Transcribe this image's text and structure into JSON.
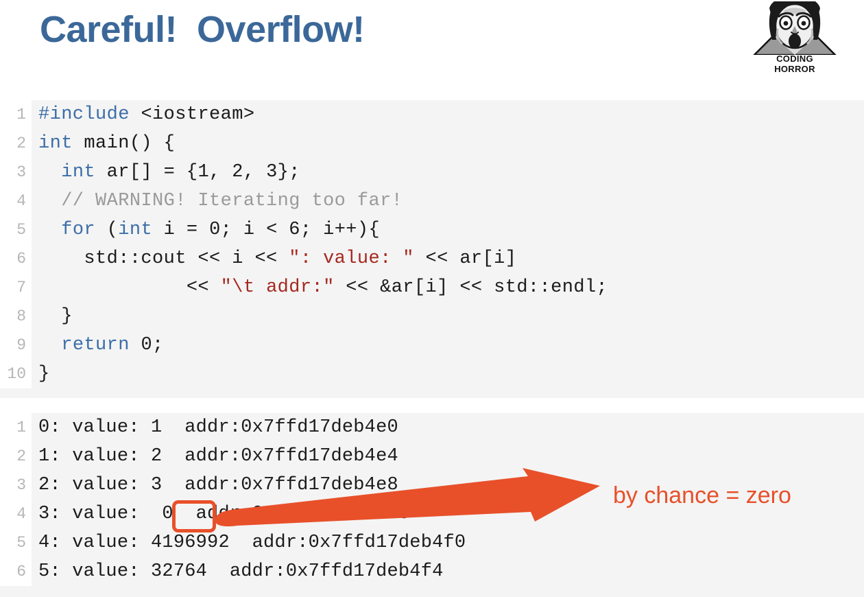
{
  "header": {
    "title": "Careful!  Overflow!",
    "title_color": "#3b6899",
    "logo": {
      "name": "coding-horror-logo",
      "line1": "CODING",
      "line2": "HORROR"
    }
  },
  "code_block": {
    "language": "cpp",
    "background": "#f4f4f4",
    "lines": [
      {
        "n": "1",
        "tokens": [
          {
            "t": "#include ",
            "c": "pre"
          },
          {
            "t": "<iostream>",
            "c": "plain"
          }
        ]
      },
      {
        "n": "2",
        "tokens": [
          {
            "t": "int",
            "c": "kw"
          },
          {
            "t": " main() {",
            "c": "plain"
          }
        ]
      },
      {
        "n": "3",
        "tokens": [
          {
            "t": "  ",
            "c": "plain"
          },
          {
            "t": "int",
            "c": "kw"
          },
          {
            "t": " ar[] = {1, 2, 3};",
            "c": "plain"
          }
        ]
      },
      {
        "n": "4",
        "tokens": [
          {
            "t": "  // WARNING! Iterating too far!",
            "c": "cmt"
          }
        ]
      },
      {
        "n": "5",
        "tokens": [
          {
            "t": "  ",
            "c": "plain"
          },
          {
            "t": "for",
            "c": "kw"
          },
          {
            "t": " (",
            "c": "plain"
          },
          {
            "t": "int",
            "c": "kw"
          },
          {
            "t": " i = 0; i < 6; i++){",
            "c": "plain"
          }
        ]
      },
      {
        "n": "6",
        "tokens": [
          {
            "t": "    std::cout << i << ",
            "c": "plain"
          },
          {
            "t": "\": value: \"",
            "c": "str"
          },
          {
            "t": " << ar[i]",
            "c": "plain"
          }
        ]
      },
      {
        "n": "7",
        "tokens": [
          {
            "t": "             << ",
            "c": "plain"
          },
          {
            "t": "\"\\t addr:\"",
            "c": "str"
          },
          {
            "t": " << &ar[i] << std::endl;",
            "c": "plain"
          }
        ]
      },
      {
        "n": "8",
        "tokens": [
          {
            "t": "  }",
            "c": "plain"
          }
        ]
      },
      {
        "n": "9",
        "tokens": [
          {
            "t": "  ",
            "c": "plain"
          },
          {
            "t": "return",
            "c": "kw"
          },
          {
            "t": " 0;",
            "c": "plain"
          }
        ]
      },
      {
        "n": "10",
        "tokens": [
          {
            "t": "}",
            "c": "plain"
          }
        ]
      }
    ]
  },
  "output_block": {
    "background": "#f4f4f4",
    "lines": [
      {
        "n": "1",
        "tokens": [
          {
            "t": "0: value: 1  addr:0x7ffd17deb4e0",
            "c": "plain"
          }
        ]
      },
      {
        "n": "2",
        "tokens": [
          {
            "t": "1: value: 2  addr:0x7ffd17deb4e4",
            "c": "plain"
          }
        ]
      },
      {
        "n": "3",
        "tokens": [
          {
            "t": "2: value: 3  addr:0x7ffd17deb4e8",
            "c": "plain"
          }
        ]
      },
      {
        "n": "4",
        "tokens": [
          {
            "t": "3: value:  0  addr:0x7ffd17deb4ec",
            "c": "plain"
          }
        ]
      },
      {
        "n": "5",
        "tokens": [
          {
            "t": "4: value: 4196992  addr:0x7ffd17deb4f0",
            "c": "plain"
          }
        ]
      },
      {
        "n": "6",
        "tokens": [
          {
            "t": "5: value: 32764  addr:0x7ffd17deb4f4",
            "c": "plain"
          }
        ]
      }
    ]
  },
  "annotations": {
    "accent_color": "#e8502a",
    "callout_text": "by chance = zero",
    "highlight_target": "0",
    "arrow": "arrow-right"
  }
}
